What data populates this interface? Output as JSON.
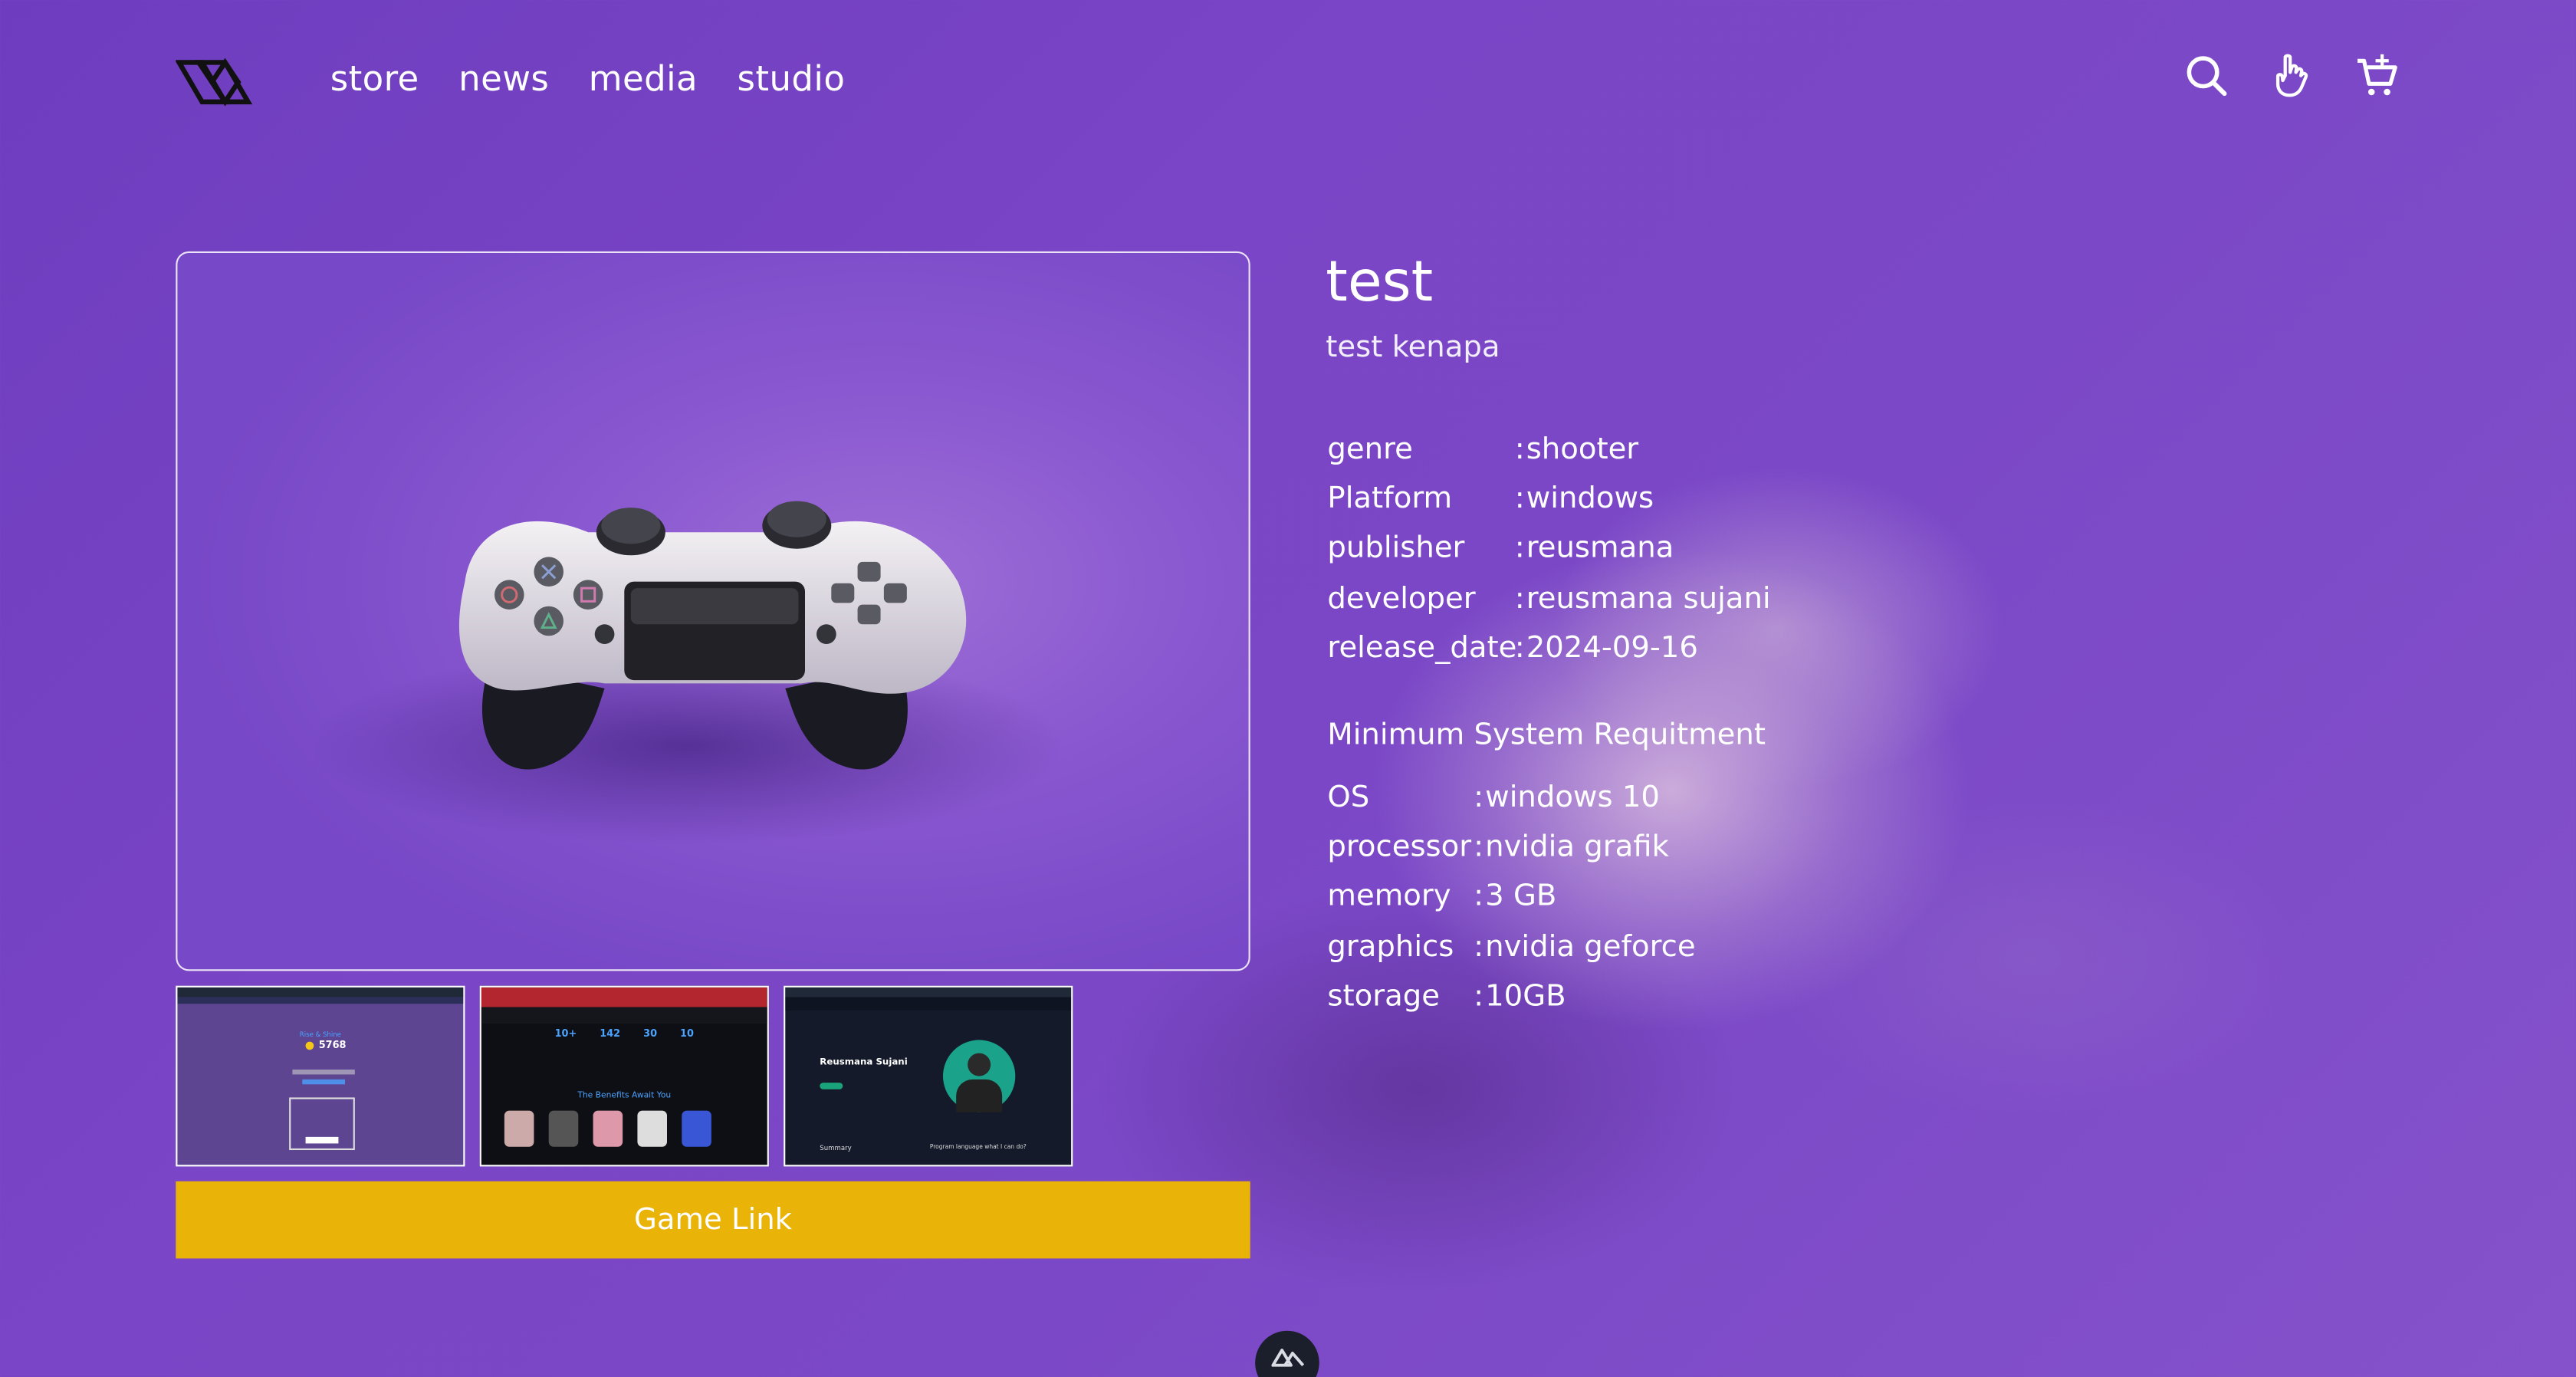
{
  "nav": {
    "links": [
      "store",
      "news",
      "media",
      "studio"
    ],
    "icons": [
      "search-icon",
      "hand-pointer-icon",
      "cart-add-icon"
    ]
  },
  "game": {
    "title": "test",
    "subtitle": "test kenapa",
    "info": [
      {
        "key": "genre",
        "value": "shooter"
      },
      {
        "key": "Platform",
        "value": "windows"
      },
      {
        "key": "publisher",
        "value": "reusmana"
      },
      {
        "key": "developer",
        "value": "reusmana sujani"
      },
      {
        "key": "release_date",
        "value": "2024-09-16"
      }
    ],
    "requirements_title": "Minimum System Requitment",
    "requirements": [
      {
        "key": "OS",
        "value": "windows 10"
      },
      {
        "key": "processor",
        "value": "nvidia grafik"
      },
      {
        "key": "memory",
        "value": "3 GB"
      },
      {
        "key": "graphics",
        "value": "nvidia geforce"
      },
      {
        "key": "storage",
        "value": "10GB"
      }
    ],
    "link_label": "Game Link"
  },
  "thumbnails": {
    "t1": {
      "title": "Rise & Shine",
      "amount": "5768"
    },
    "t2": {
      "stats": [
        "10+",
        "142",
        "30",
        "10"
      ],
      "headline": "The Benefits Await You"
    },
    "t3": {
      "name": "Reusmana Sujani",
      "section": "Summary",
      "subheading": "Program language what I can do?"
    }
  },
  "colors": {
    "background": "#7a45c6",
    "accent": "#eab308",
    "text": "#ffffff"
  }
}
